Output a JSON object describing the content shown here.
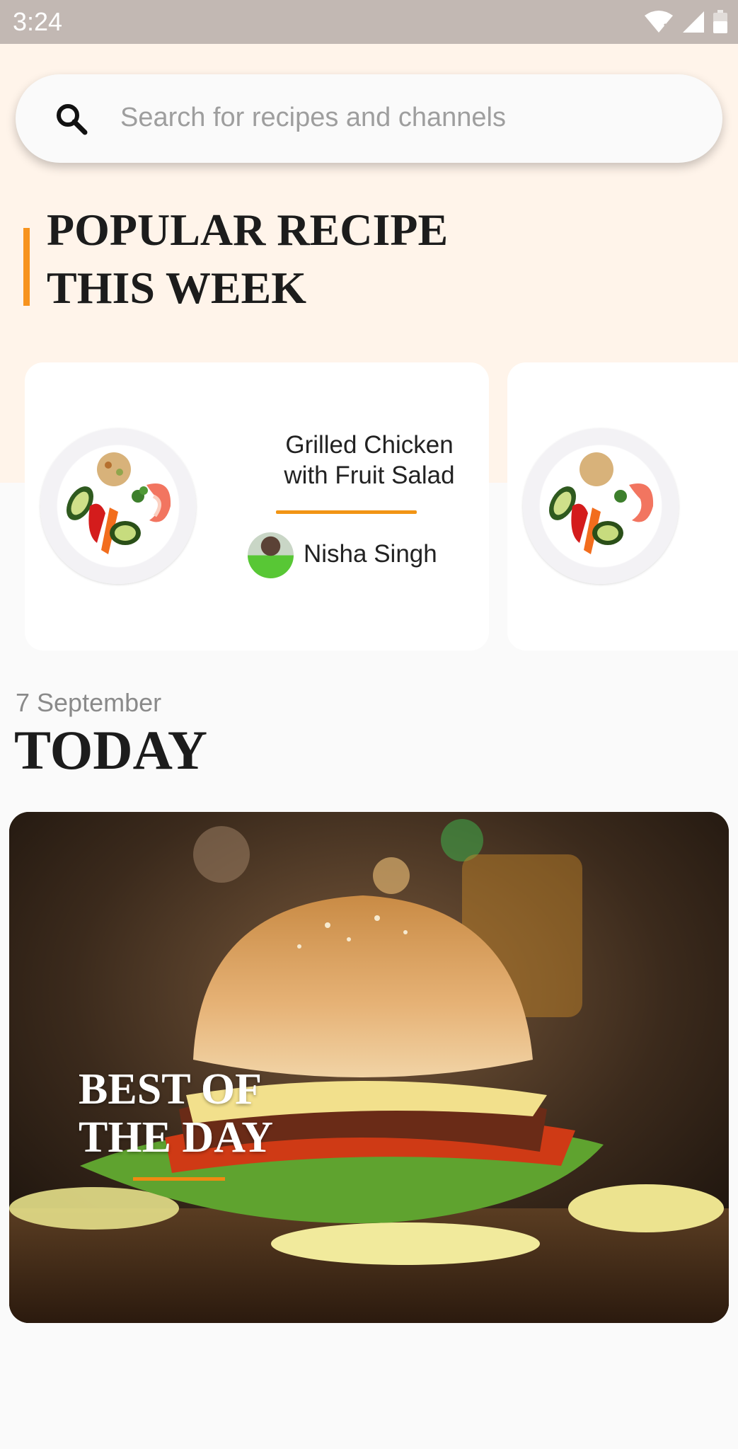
{
  "status_bar": {
    "time": "3:24"
  },
  "search": {
    "placeholder": "Search for recipes and channels",
    "icon": "search-icon"
  },
  "popular": {
    "title": "POPULAR RECIPE\nTHIS WEEK",
    "accent_color": "#f7931e",
    "cards": [
      {
        "title": "Grilled Chicken\nwith Fruit Salad",
        "author": "Nisha Singh"
      }
    ]
  },
  "today": {
    "date": "7 September",
    "heading": "TODAY",
    "feature": {
      "title": "BEST OF\nTHE DAY",
      "accent_color": "#f08a12"
    }
  },
  "colors": {
    "background": "#fafafa",
    "header_background": "#fff4ea",
    "status_bar": "#c2b8b3"
  }
}
